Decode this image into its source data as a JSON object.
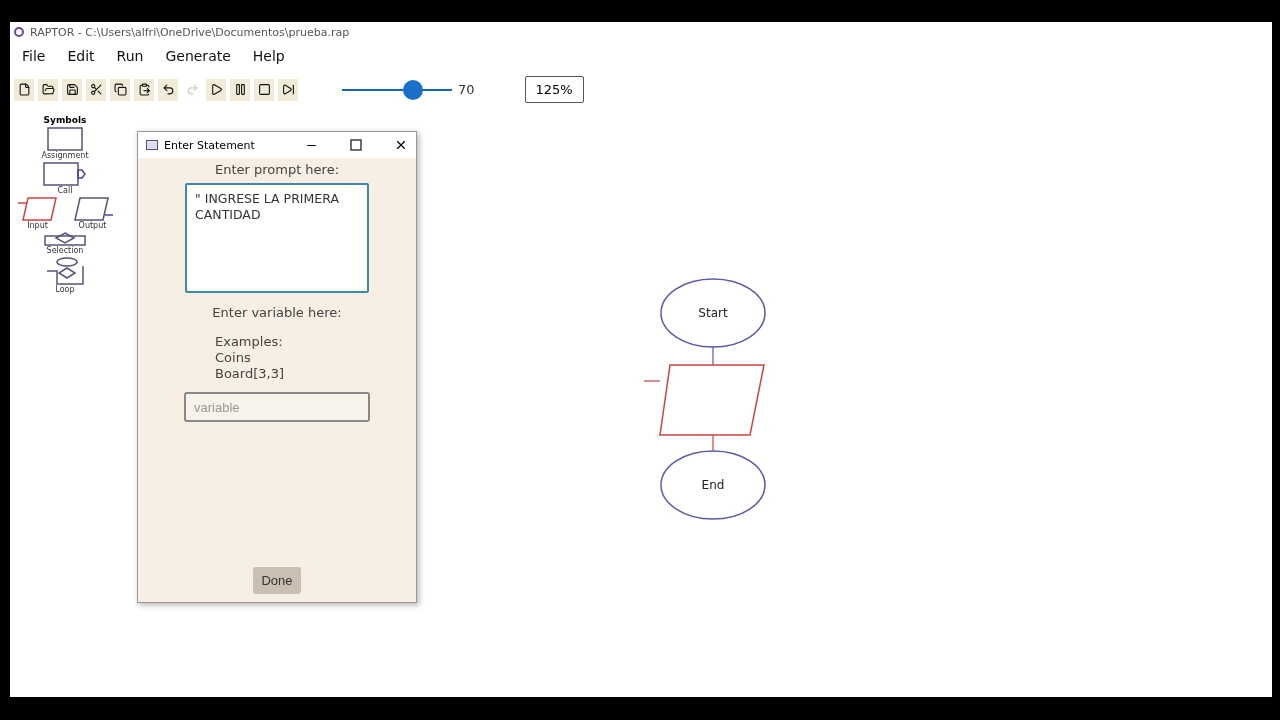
{
  "window": {
    "title": "RAPTOR - C:\\Users\\alfri\\OneDrive\\Documentos\\prueba.rap"
  },
  "menu": [
    "File",
    "Edit",
    "Run",
    "Generate",
    "Help"
  ],
  "toolbar": [
    {
      "kind": "new",
      "disabled": false
    },
    {
      "kind": "open",
      "disabled": false
    },
    {
      "kind": "save",
      "disabled": false
    },
    {
      "kind": "cut",
      "disabled": false
    },
    {
      "kind": "copy",
      "disabled": false
    },
    {
      "kind": "paste",
      "disabled": false
    },
    {
      "kind": "undo",
      "disabled": false
    },
    {
      "kind": "redo",
      "disabled": true
    },
    {
      "kind": "play",
      "disabled": false
    },
    {
      "kind": "pause",
      "disabled": false
    },
    {
      "kind": "stop",
      "disabled": false
    },
    {
      "kind": "step",
      "disabled": false
    }
  ],
  "speed": {
    "level": 0.68,
    "reading": "70"
  },
  "zoom": "125%",
  "symbols": {
    "title": "Symbols",
    "items": [
      {
        "kind": "assignment",
        "label": "Assignment"
      },
      {
        "kind": "call",
        "label": "Call"
      },
      {
        "kind": "input",
        "label": "Input"
      },
      {
        "kind": "output",
        "label": "Output"
      },
      {
        "kind": "selection",
        "label": "Selection"
      },
      {
        "kind": "loop",
        "label": "Loop"
      }
    ]
  },
  "dialog": {
    "title": "Enter Statement",
    "prompt_label": "Enter prompt here:",
    "prompt_value": "\" INGRESE LA PRIMERA CANTIDAD",
    "variable_label": "Enter variable here:",
    "examples": [
      "Examples:",
      "Coins",
      "Board[3,3]"
    ],
    "variable_placeholder": "variable",
    "done": "Done"
  },
  "flowchart": [
    {
      "kind": "terminal",
      "label": "Start"
    },
    {
      "kind": "input"
    },
    {
      "kind": "terminal",
      "label": "End"
    }
  ]
}
